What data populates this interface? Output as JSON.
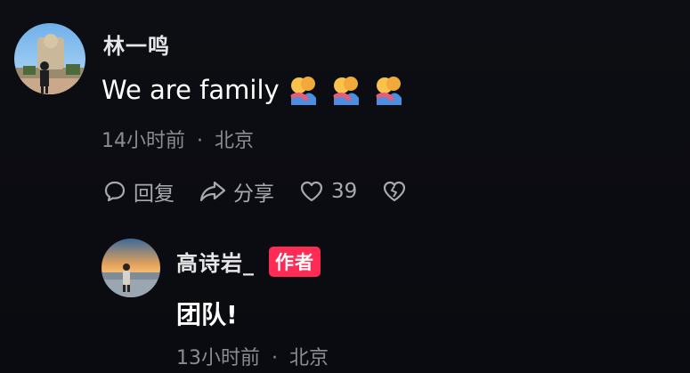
{
  "comment": {
    "author": "林一鸣",
    "text": "We are family",
    "emojis": [
      "people-hugging-emoji",
      "people-hugging-emoji",
      "people-hugging-emoji"
    ],
    "time": "14小时前",
    "separator": "·",
    "location": "北京",
    "actions": {
      "reply_label": "回复",
      "share_label": "分享",
      "like_count": "39"
    }
  },
  "reply": {
    "author": "高诗岩_",
    "badge": "作者",
    "text": "团队!",
    "time": "13小时前",
    "separator": "·",
    "location": "北京"
  },
  "colors": {
    "background": "#0c0d12",
    "author_badge": "#fe2c55",
    "meta_text": "#8b8c93",
    "action_text": "#a8a9b0"
  }
}
